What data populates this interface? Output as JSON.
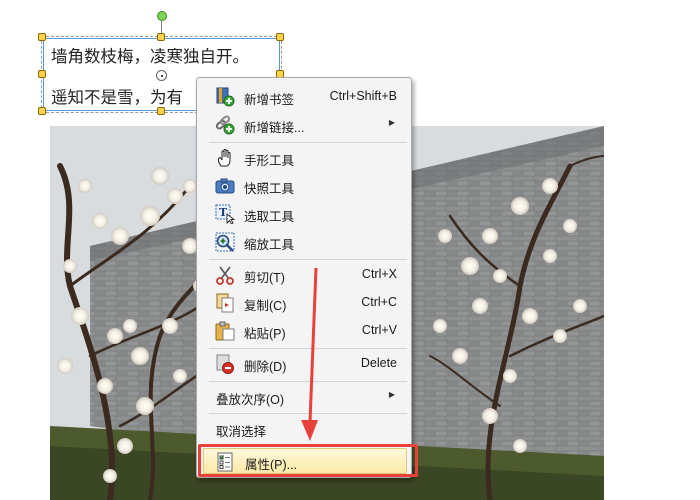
{
  "textbox": {
    "line1": "墙角数枝梅，凌寒独自开。",
    "line2": "遥知不是雪，为有"
  },
  "context_menu": {
    "items": [
      {
        "label": "新增书签",
        "shortcut": "Ctrl+Shift+B",
        "icon": "bookmark-add-icon"
      },
      {
        "label": "新增链接...",
        "submenu": true,
        "icon": "link-add-icon"
      },
      {
        "label": "手形工具",
        "icon": "hand-tool-icon"
      },
      {
        "label": "快照工具",
        "icon": "camera-icon"
      },
      {
        "label": "选取工具",
        "icon": "text-select-icon"
      },
      {
        "label": "缩放工具",
        "icon": "zoom-icon"
      },
      {
        "label": "剪切(T)",
        "shortcut": "Ctrl+X",
        "icon": "scissors-icon"
      },
      {
        "label": "复制(C)",
        "shortcut": "Ctrl+C",
        "icon": "copy-icon"
      },
      {
        "label": "粘贴(P)",
        "shortcut": "Ctrl+V",
        "icon": "paste-icon"
      },
      {
        "label": "删除(D)",
        "shortcut": "Delete",
        "icon": "delete-icon"
      },
      {
        "label": "叠放次序(O)",
        "submenu": true
      },
      {
        "label": "取消选择"
      },
      {
        "label": "属性(P)...",
        "icon": "properties-icon",
        "highlighted": true
      }
    ],
    "submenu_arrow": "▶"
  },
  "colors": {
    "annotation_red": "#e8413b",
    "highlight_fill": "#fbe9a6",
    "selection_blue": "#5b9bd5"
  }
}
